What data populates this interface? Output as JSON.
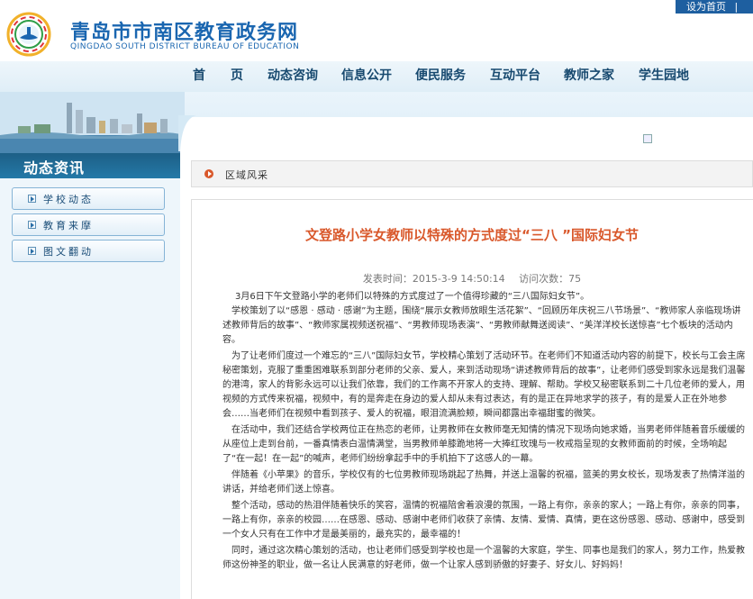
{
  "header": {
    "site_title": "青岛市市南区教育政务网",
    "site_subtitle": "QINGDAO SOUTH DISTRICT BUREAU OF EDUCATION",
    "set_home": "设为首页",
    "separator": "|",
    "favorite": "好"
  },
  "nav": {
    "items": [
      "首　　页",
      "动态咨询",
      "信息公开",
      "便民服务",
      "互动平台",
      "教师之家",
      "学生园地"
    ]
  },
  "sidebar": {
    "title": "动态资讯",
    "items": [
      "学校动态",
      "教育来摩",
      "图文翻动"
    ]
  },
  "breadcrumb": "区域风采",
  "article": {
    "title": "文登路小学女教师以特殊的方式度过“三八 ”国际妇女节",
    "date": "发表时间：2015-3-9 14:50:14",
    "views": "访问次数：75",
    "paragraphs": [
      "3月6日下午文登路小学的老师们以特殊的方式度过了一个值得珍藏的“三八国际妇女节”。",
      "　学校策划了以“感恩 · 感动 · 感谢”为主题，围绕“展示女教师放眼生活花絮”、“回顾历年庆祝三八节场景”、“教师家人亲临现场讲述教师背后的故事”、“教师家属视频送祝福”、“男教师现场表演”、“男教师献舞送阅读”、“美洋洋校长送惊喜”七个板块的活动内容。",
      "　为了让老师们度过一个难忘的“三八”国际妇女节，学校精心策划了活动环节。在老师们不知道活动内容的前提下，校长与工会主席秘密策划，克服了重重困难联系到部分老师的父亲、爱人，来到活动现场“讲述教师背后的故事”，让老师们感受到家永远是我们温馨的港湾，家人的背影永远可以让我们依靠，我们的工作离不开家人的支持、理解、帮助。学校又秘密联系到二十几位老师的爱人，用视频的方式传来祝福，视频中，有的是奔走在身边的爱人却从未有过表达，有的是正在异地求学的孩子，有的是爱人正在外地参会……当老师们在视频中看到孩子、爱人的祝福，眼泪流满脸颊，瞬间都露出幸福甜蜜的微笑。",
      "　在活动中，我们还结合学校两位正在热恋的老师，让男教师在女教师毫无知情的情况下现场向她求婚，当男老师伴随着音乐缓缓的从座位上走到台前，一番真情表白温情满堂，当男教师单膝跪地将一大捧红玫瑰与一枚戒指呈现的女教师面前的时候，全场响起了“在一起！在一起”的喊声，老师们纷纷拿起手中的手机拍下了这感人的一幕。",
      "　伴随着《小苹果》的音乐，学校仅有的七位男教师现场跳起了热舞，并送上温馨的祝福，篮美的男女校长，现场发表了热情洋溢的讲话，并给老师们送上惊喜。",
      "　整个活动，感动的热泪伴随着快乐的笑容，温情的祝福陪舍着浪漫的氛围，一路上有你，亲亲的家人；一路上有你，亲亲的同事，一路上有你，亲亲的校园……在感恩、感动、感谢中老师们收获了亲情、友情、爱情、真情，更在这份感恩、感动、感谢中，感受到一个女人只有在工作中才是最美丽的，最充实的，最幸福的！",
      "　同时，通过这次精心策划的活动，也让老师们感受到学校也是一个温馨的大家庭，学生、同事也是我们的家人，努力工作，热爱教师这份神圣的职业，做一名让人民满意的好老师，做一个让家人感到骄傲的好妻子、好女儿、好妈妈！"
    ]
  },
  "colors": {
    "brand_blue": "#1a66b0",
    "title_orange": "#d9582b",
    "sidebar_blue": "#1e6e9b"
  }
}
